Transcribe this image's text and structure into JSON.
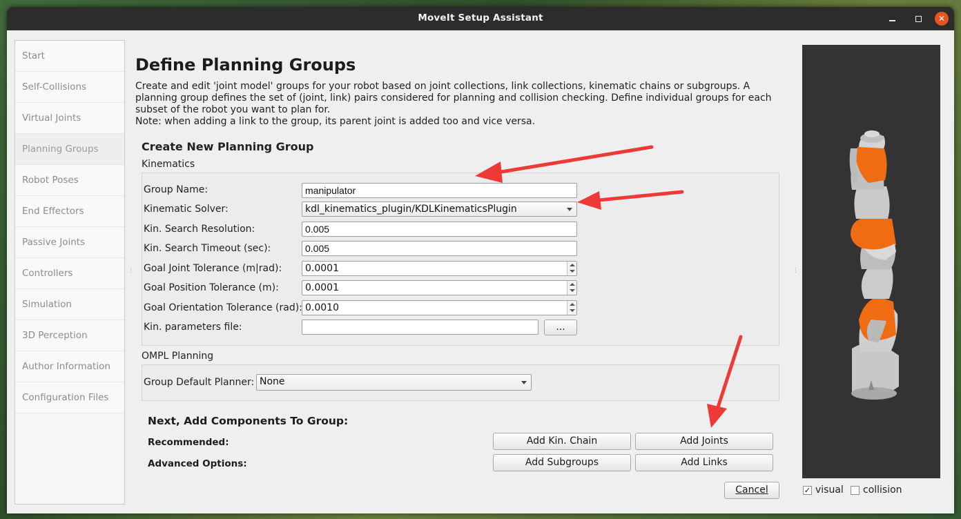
{
  "window": {
    "title": "MoveIt Setup Assistant"
  },
  "sidebar": {
    "items": [
      {
        "label": "Start"
      },
      {
        "label": "Self-Collisions"
      },
      {
        "label": "Virtual Joints"
      },
      {
        "label": "Planning Groups"
      },
      {
        "label": "Robot Poses"
      },
      {
        "label": "End Effectors"
      },
      {
        "label": "Passive Joints"
      },
      {
        "label": "Controllers"
      },
      {
        "label": "Simulation"
      },
      {
        "label": "3D Perception"
      },
      {
        "label": "Author Information"
      },
      {
        "label": "Configuration Files"
      }
    ]
  },
  "page": {
    "title": "Define Planning Groups",
    "description": "Create and edit 'joint model' groups for your robot based on joint collections, link collections, kinematic chains or subgroups. A planning group defines the set of (joint, link) pairs considered for planning and collision checking. Define individual groups for each subset of the robot you want to plan for.",
    "note": "Note: when adding a link to the group, its parent joint is added too and vice versa."
  },
  "create_group": {
    "title": "Create New Planning Group",
    "kinematics_label": "Kinematics",
    "group_name_label": "Group Name:",
    "group_name_value": "manipulator",
    "solver_label": "Kinematic Solver:",
    "solver_value": "kdl_kinematics_plugin/KDLKinematicsPlugin",
    "resolution_label": "Kin. Search Resolution:",
    "resolution_value": "0.005",
    "timeout_label": "Kin. Search Timeout (sec):",
    "timeout_value": "0.005",
    "joint_tol_label": "Goal Joint Tolerance (m|rad):",
    "joint_tol_value": "0.0001",
    "pos_tol_label": "Goal Position Tolerance (m):",
    "pos_tol_value": "0.0001",
    "orient_tol_label": "Goal Orientation Tolerance (rad):",
    "orient_tol_value": "0.0010",
    "params_file_label": "Kin. parameters file:",
    "params_file_value": "",
    "browse_label": "...",
    "ompl_label": "OMPL Planning",
    "planner_label": "Group Default Planner:",
    "planner_value": "None"
  },
  "components": {
    "title": "Next, Add Components To Group:",
    "recommended_label": "Recommended:",
    "advanced_label": "Advanced Options:",
    "add_kin_chain": "Add Kin. Chain",
    "add_joints": "Add Joints",
    "add_subgroups": "Add Subgroups",
    "add_links": "Add Links",
    "cancel": "Cancel"
  },
  "viewer": {
    "visual_label": "visual",
    "visual_checked": true,
    "collision_label": "collision",
    "collision_checked": false,
    "robot_colors": {
      "body": "#c8c8c8",
      "accent": "#ef6c12",
      "background": "#333333"
    }
  },
  "annotations": {
    "arrow_color": "#ee3a36"
  }
}
